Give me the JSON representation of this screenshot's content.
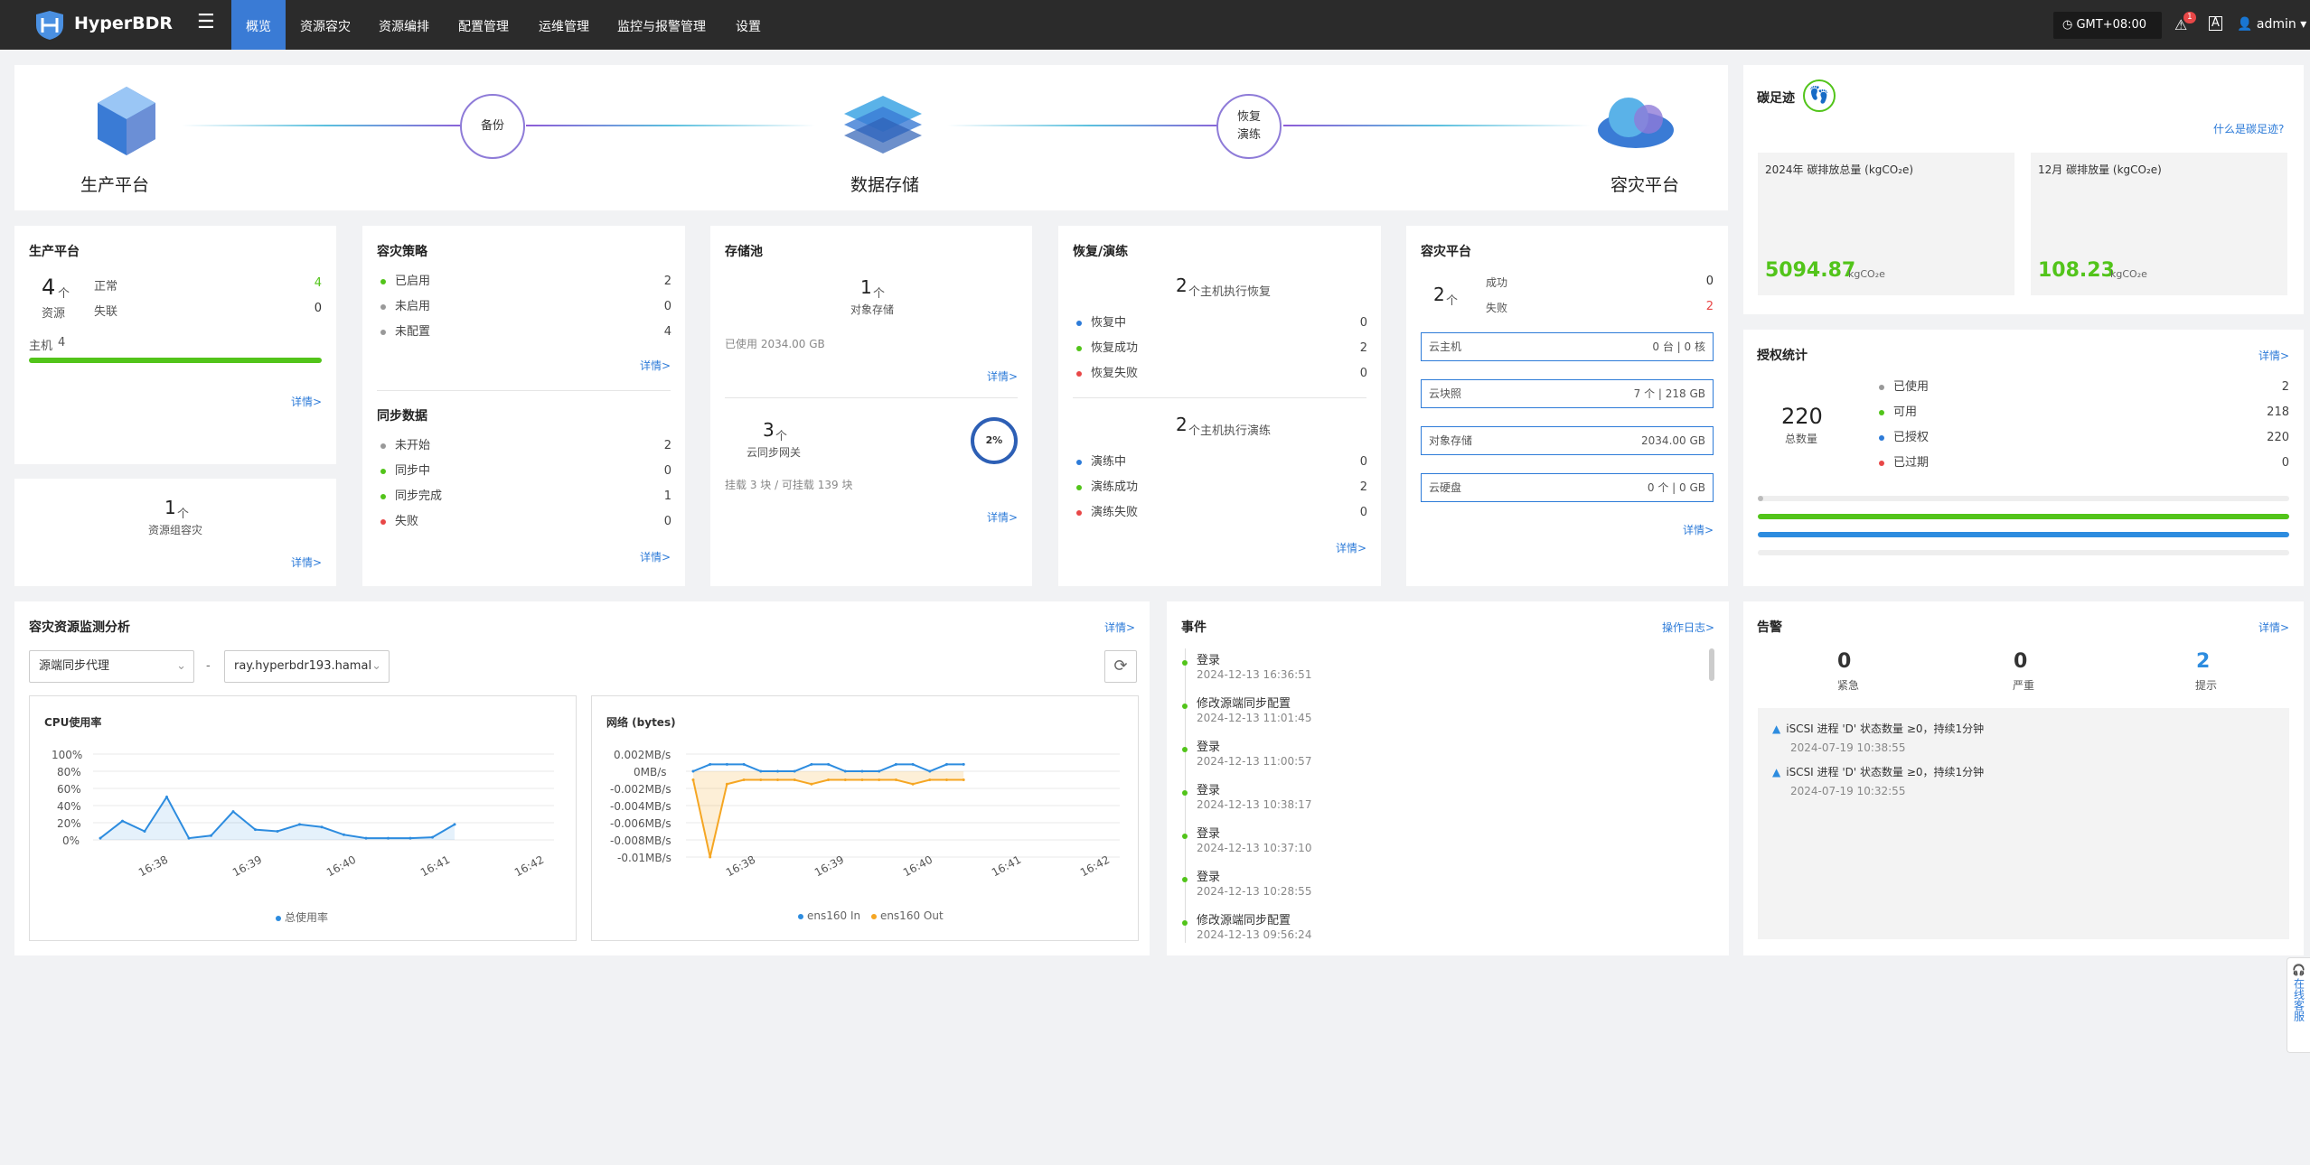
{
  "nav": {
    "brand": "HyperBDR",
    "items": [
      "概览",
      "资源容灾",
      "资源编排",
      "配置管理",
      "运维管理",
      "监控与报警管理",
      "设置"
    ],
    "timezone": "GMT+08:00",
    "alert_count": "1",
    "user": "admin"
  },
  "flow": {
    "prod": "生产平台",
    "backup": "备份",
    "storage": "数据存储",
    "restore1": "恢复",
    "restore2": "演练",
    "dr": "容灾平台"
  },
  "carbon": {
    "title": "碳足迹",
    "what": "什么是碳足迹?",
    "year_label": "2024年 碳排放总量 (kgCO₂e)",
    "year_value": "5094.87",
    "month_label": "12月 碳排放量 (kgCO₂e)",
    "month_value": "108.23",
    "unit": "kgCO₂e"
  },
  "prod": {
    "title": "生产平台",
    "count": "4",
    "unit": "个",
    "res": "资源",
    "normal_label": "正常",
    "normal": "4",
    "lost_label": "失联",
    "lost": "0",
    "host_label": "主机",
    "host": "4",
    "detail": "详情>"
  },
  "group": {
    "count": "1",
    "unit": "个",
    "label": "资源组容灾",
    "detail": "详情>"
  },
  "policy": {
    "title": "容灾策略",
    "items": [
      {
        "label": "已启用",
        "value": "2"
      },
      {
        "label": "未启用",
        "value": "0"
      },
      {
        "label": "未配置",
        "value": "4"
      }
    ],
    "detail": "详情>"
  },
  "sync": {
    "title": "同步数据",
    "items": [
      {
        "label": "未开始",
        "value": "2"
      },
      {
        "label": "同步中",
        "value": "0"
      },
      {
        "label": "同步完成",
        "value": "1"
      },
      {
        "label": "失败",
        "value": "0"
      }
    ],
    "detail": "详情>"
  },
  "pool": {
    "title": "存储池",
    "count": "1",
    "unit": "个",
    "label": "对象存储",
    "used": "已使用 2034.00 GB",
    "detail": "详情>",
    "gw_count": "3",
    "gw_unit": "个",
    "gw_label": "云同步网关",
    "gw_pct": "2%",
    "gw_mount": "挂载 3 块 / 可挂载 139 块",
    "detail2": "详情>"
  },
  "recover": {
    "title": "恢复/演练",
    "r_count": "2",
    "r_label": "个主机执行恢复",
    "r_items": [
      {
        "label": "恢复中",
        "value": "0"
      },
      {
        "label": "恢复成功",
        "value": "2"
      },
      {
        "label": "恢复失败",
        "value": "0"
      }
    ],
    "d_count": "2",
    "d_label": "个主机执行演练",
    "d_items": [
      {
        "label": "演练中",
        "value": "0"
      },
      {
        "label": "演练成功",
        "value": "2"
      },
      {
        "label": "演练失败",
        "value": "0"
      }
    ],
    "detail": "详情>"
  },
  "drp": {
    "title": "容灾平台",
    "count": "2",
    "unit": "个",
    "ok_label": "成功",
    "ok": "0",
    "fail_label": "失败",
    "fail": "2",
    "rows": [
      {
        "label": "云主机",
        "value": "0 台 | 0 核"
      },
      {
        "label": "云块照",
        "value": "7 个 | 218 GB"
      },
      {
        "label": "对象存储",
        "value": "2034.00 GB"
      },
      {
        "label": "云硬盘",
        "value": "0 个 | 0 GB"
      }
    ],
    "detail": "详情>"
  },
  "license": {
    "title": "授权统计",
    "detail": "详情>",
    "total": "220",
    "total_label": "总数量",
    "items": [
      {
        "label": "已使用",
        "value": "2"
      },
      {
        "label": "可用",
        "value": "218"
      },
      {
        "label": "已授权",
        "value": "220"
      },
      {
        "label": "已过期",
        "value": "0"
      }
    ]
  },
  "monitor": {
    "title": "容灾资源监测分析",
    "detail": "详情>",
    "sel1": "源端同步代理",
    "dash": "-",
    "sel2": "ray.hyperbdr193.hamal."
  },
  "cpu": {
    "title": "CPU使用率",
    "yticks": [
      "100%",
      "80%",
      "60%",
      "40%",
      "20%",
      "0%"
    ],
    "xticks": [
      "16:38",
      "16:39",
      "16:40",
      "16:41",
      "16:42"
    ],
    "legend": "总使用率"
  },
  "net": {
    "title": "网络 (bytes)",
    "yticks": [
      "0.002MB/s",
      "0MB/s",
      "-0.002MB/s",
      "-0.004MB/s",
      "-0.006MB/s",
      "-0.008MB/s",
      "-0.01MB/s"
    ],
    "xticks": [
      "16:38",
      "16:39",
      "16:40",
      "16:41",
      "16:42"
    ],
    "legend_in": "ens160 In",
    "legend_out": "ens160 Out"
  },
  "chart_data": [
    {
      "type": "line",
      "title": "CPU使用率",
      "ylim": [
        0,
        100
      ],
      "yunit": "%",
      "series": [
        {
          "name": "总使用率",
          "values": [
            2,
            22,
            10,
            50,
            2,
            5,
            33,
            12,
            10,
            18,
            15,
            6,
            2,
            2,
            2,
            3,
            18
          ]
        }
      ]
    },
    {
      "type": "line",
      "title": "网络 (bytes)",
      "ylim": [
        -0.01,
        0.002
      ],
      "yunit": "MB/s",
      "series": [
        {
          "name": "ens160 In",
          "values": [
            0,
            0.0008,
            0.0008,
            0.0008,
            0,
            0,
            0,
            0.0008,
            0.0008,
            0,
            0,
            0,
            0.0008,
            0.0008,
            0,
            0.0008,
            0.0008
          ]
        },
        {
          "name": "ens160 Out",
          "values": [
            -0.001,
            -0.01,
            -0.0015,
            -0.001,
            -0.001,
            -0.001,
            -0.001,
            -0.0015,
            -0.001,
            -0.001,
            -0.001,
            -0.001,
            -0.001,
            -0.0015,
            -0.001,
            -0.001,
            -0.001
          ]
        }
      ]
    }
  ],
  "events": {
    "title": "事件",
    "link": "操作日志>",
    "items": [
      {
        "name": "登录",
        "time": "2024-12-13 16:36:51"
      },
      {
        "name": "修改源端同步配置",
        "time": "2024-12-13 11:01:45"
      },
      {
        "name": "登录",
        "time": "2024-12-13 11:00:57"
      },
      {
        "name": "登录",
        "time": "2024-12-13 10:38:17"
      },
      {
        "name": "登录",
        "time": "2024-12-13 10:37:10"
      },
      {
        "name": "登录",
        "time": "2024-12-13 10:28:55"
      },
      {
        "name": "修改源端同步配置",
        "time": "2024-12-13 09:56:24"
      }
    ]
  },
  "alerts": {
    "title": "告警",
    "detail": "详情>",
    "urgent": "0",
    "urgent_label": "紧急",
    "serious": "0",
    "serious_label": "严重",
    "hint": "2",
    "hint_label": "提示",
    "items": [
      {
        "text": "iSCSI 进程 'D' 状态数量 ≥0，持续1分钟",
        "time": "2024-07-19 10:38:55"
      },
      {
        "text": "iSCSI 进程 'D' 状态数量 ≥0，持续1分钟",
        "time": "2024-07-19 10:32:55"
      }
    ]
  },
  "service": {
    "text": "在线客服"
  }
}
